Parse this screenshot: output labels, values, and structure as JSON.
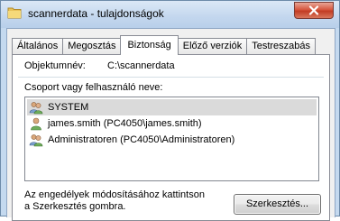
{
  "window": {
    "title": "scannerdata - tulajdonságok",
    "close_icon": "close-icon"
  },
  "tabs": [
    {
      "label": "Általános"
    },
    {
      "label": "Megosztás"
    },
    {
      "label": "Biztonság",
      "active": true
    },
    {
      "label": "Előző verziók"
    },
    {
      "label": "Testreszabás"
    }
  ],
  "security": {
    "object_label": "Objektumnév:",
    "object_value": "C:\\scannerdata",
    "group_label": "Csoport vagy felhasználó neve:",
    "principals": [
      {
        "name": "SYSTEM",
        "icon": "group-icon",
        "selected": true
      },
      {
        "name": "james.smith (PC4050\\james.smith)",
        "icon": "user-icon",
        "selected": false
      },
      {
        "name": "Administratoren (PC4050\\Administratoren)",
        "icon": "group-icon",
        "selected": false
      }
    ],
    "hint_line1": "Az engedélyek módosításához kattintson",
    "hint_line2": "a Szerkesztés gombra.",
    "edit_button": "Szerkesztés..."
  },
  "colors": {
    "window_frame": "#b9d1ea",
    "close_button": "#c23c23",
    "selected_row": "#dadada"
  }
}
